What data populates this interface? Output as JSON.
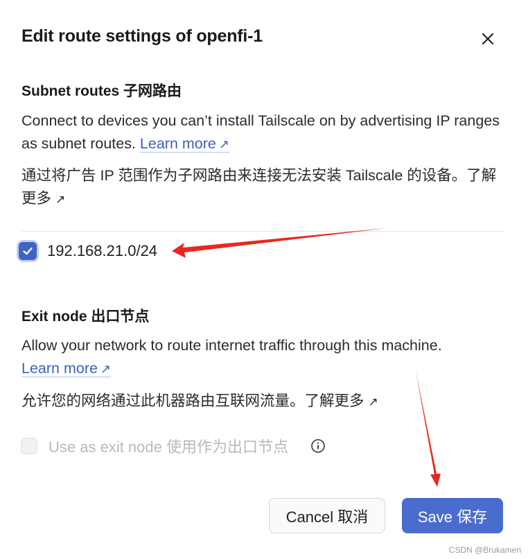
{
  "dialog": {
    "title": "Edit route settings of openfi-1"
  },
  "subnet": {
    "heading": "Subnet routes 子网路由",
    "description": "Connect to devices you can’t install Tailscale on by advertising IP ranges as subnet routes.",
    "learn_more": "Learn more",
    "cn_description": "通过将广告 IP 范围作为子网路由来连接无法安装 Tailscale 的设备。",
    "cn_learn_more": "了解更多",
    "route": "192.168.21.0/24"
  },
  "exit_node": {
    "heading": "Exit node 出口节点",
    "description": "Allow your network to route internet traffic through this machine.",
    "learn_more": "Learn more",
    "cn_description": "允许您的网络通过此机器路由互联网流量。",
    "cn_learn_more": "了解更多",
    "checkbox_label": "Use as exit node 使用作为出口节点"
  },
  "footer": {
    "cancel_label": "Cancel 取消",
    "save_label": "Save 保存"
  },
  "watermark": "CSDN @Brukamen",
  "colors": {
    "accent": "#4a6cce",
    "link": "#3b63b6",
    "annotation_arrow": "#e8281e"
  }
}
